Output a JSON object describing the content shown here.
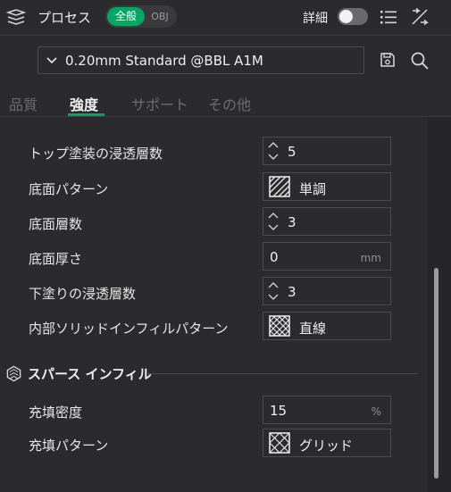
{
  "header": {
    "title": "プロセス",
    "segment": {
      "active": "全般",
      "inactive": "OBJ"
    },
    "advanced_label": "詳細"
  },
  "preset": {
    "name": "0.20mm Standard @BBL A1M"
  },
  "tabs": [
    {
      "label": "品質",
      "active": false
    },
    {
      "label": "強度",
      "active": true
    },
    {
      "label": "サポート",
      "active": false
    },
    {
      "label": "その他",
      "active": false
    }
  ],
  "rows": {
    "top_density": {
      "label": "トップ塗装の浸透層数",
      "value": "5"
    },
    "bottom_pattern": {
      "label": "底面パターン",
      "value": "単調",
      "icon": "monotonic-pattern-icon"
    },
    "bottom_layers": {
      "label": "底面層数",
      "value": "3"
    },
    "bottom_thickness": {
      "label": "底面厚さ",
      "value": "0",
      "unit": "mm"
    },
    "bottom_density": {
      "label": "下塗りの浸透層数",
      "value": "3"
    },
    "internal_solid_pattern": {
      "label": "内部ソリッドインフィルパターン",
      "value": "直線",
      "icon": "rectilinear-pattern-icon"
    }
  },
  "sections": {
    "sparse_infill": {
      "title": "スパース インフィル",
      "rows": {
        "infill_density": {
          "label": "充填密度",
          "value": "15",
          "unit": "%"
        },
        "infill_pattern": {
          "label": "充填パターン",
          "value": "グリッド",
          "icon": "grid-pattern-icon"
        }
      }
    }
  },
  "colors": {
    "accent": "#00a862",
    "background": "#2b2b2d",
    "text": "#e6e6e6"
  }
}
